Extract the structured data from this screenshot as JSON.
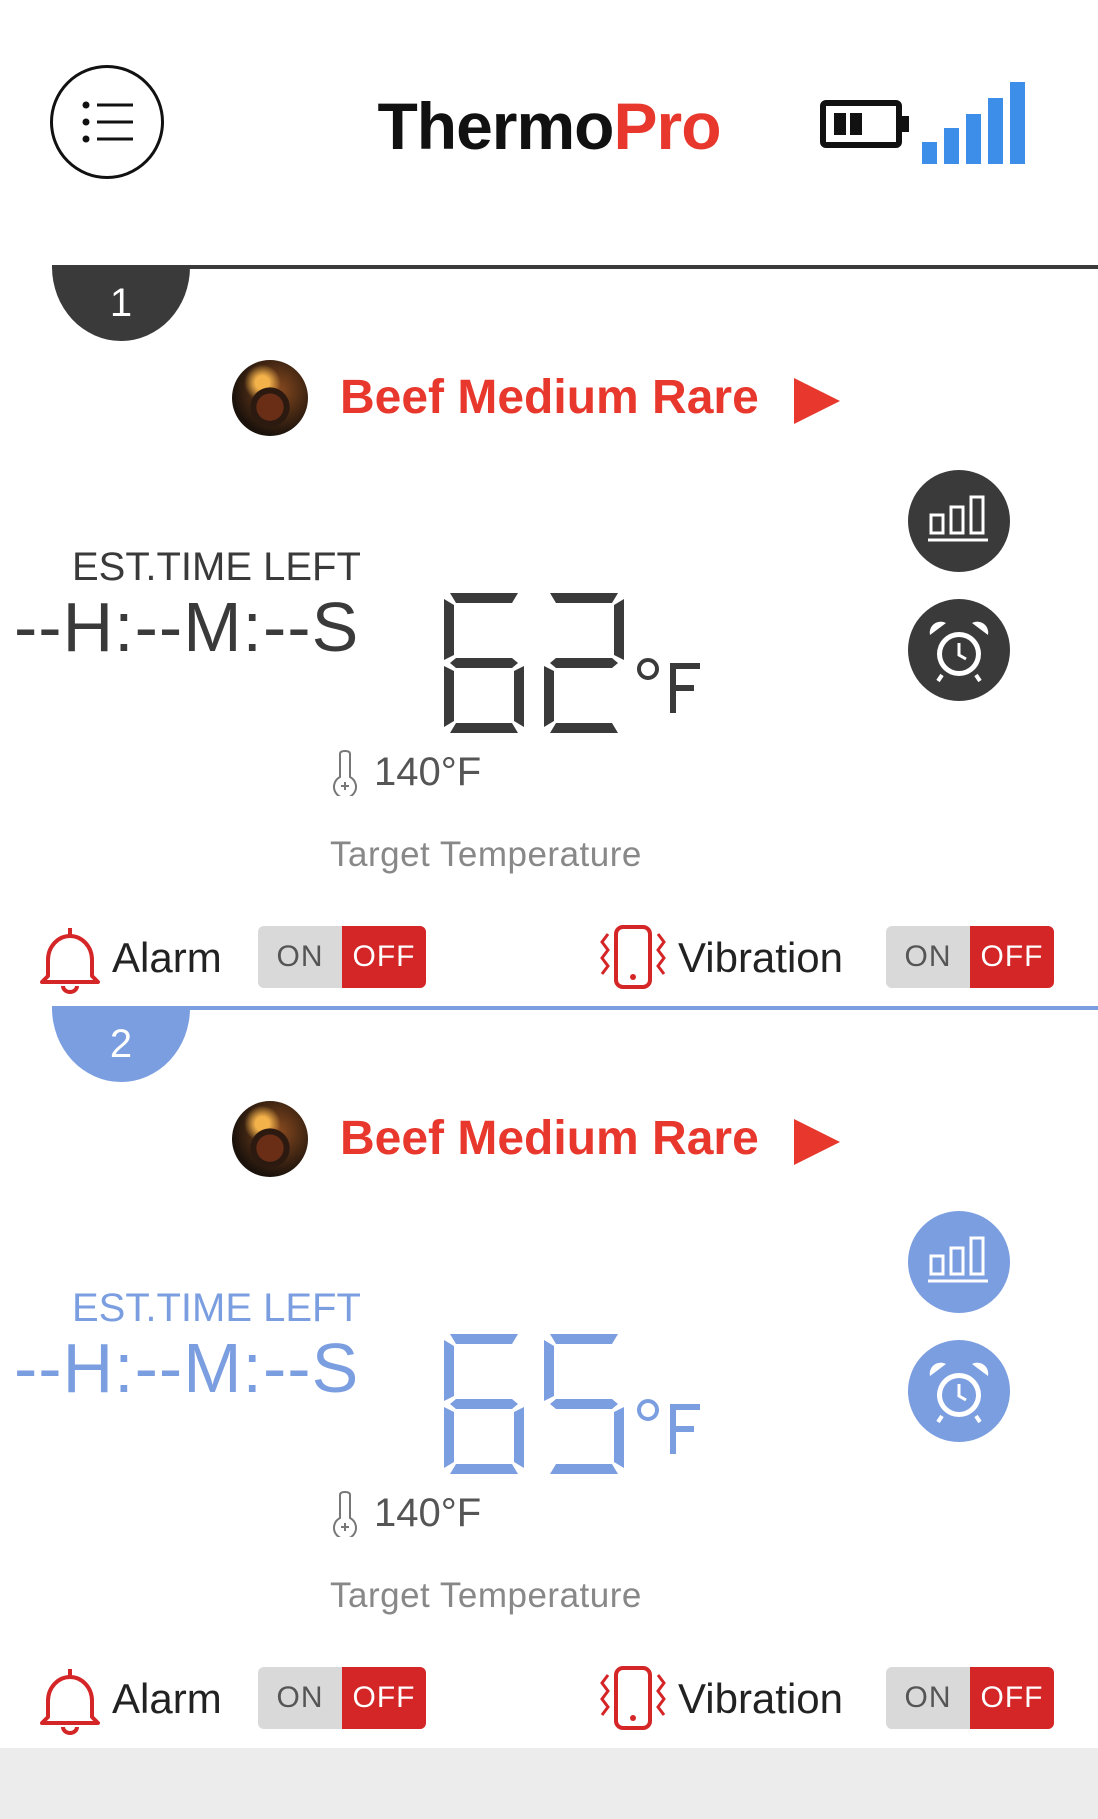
{
  "header": {
    "title_part1": "Thermo",
    "title_part2": "Pro",
    "menu_icon": "list-menu-icon",
    "battery_icon": "battery-icon",
    "signal_icon": "signal-strength-icon"
  },
  "colors": {
    "probe1_accent": "#3a3a3a",
    "probe2_accent": "#7b9ee0",
    "brand_red": "#e8372c",
    "toggle_off_red": "#d42527",
    "signal_blue": "#3d8ee8"
  },
  "probes": [
    {
      "number": "1",
      "food": "Beef Medium Rare",
      "est_label": "EST.TIME LEFT",
      "est_time": "--H:--M:--S",
      "temperature": "62",
      "unit": "°F",
      "target_temp": "140°F",
      "target_label": "Target Temperature",
      "alarm_label": "Alarm",
      "alarm_on": "ON",
      "alarm_off": "OFF",
      "vibration_label": "Vibration",
      "vibration_on": "ON",
      "vibration_off": "OFF"
    },
    {
      "number": "2",
      "food": "Beef Medium Rare",
      "est_label": "EST.TIME LEFT",
      "est_time": "--H:--M:--S",
      "temperature": "65",
      "unit": "°F",
      "target_temp": "140°F",
      "target_label": "Target Temperature",
      "alarm_label": "Alarm",
      "alarm_on": "ON",
      "alarm_off": "OFF",
      "vibration_label": "Vibration",
      "vibration_on": "ON",
      "vibration_off": "OFF"
    }
  ]
}
